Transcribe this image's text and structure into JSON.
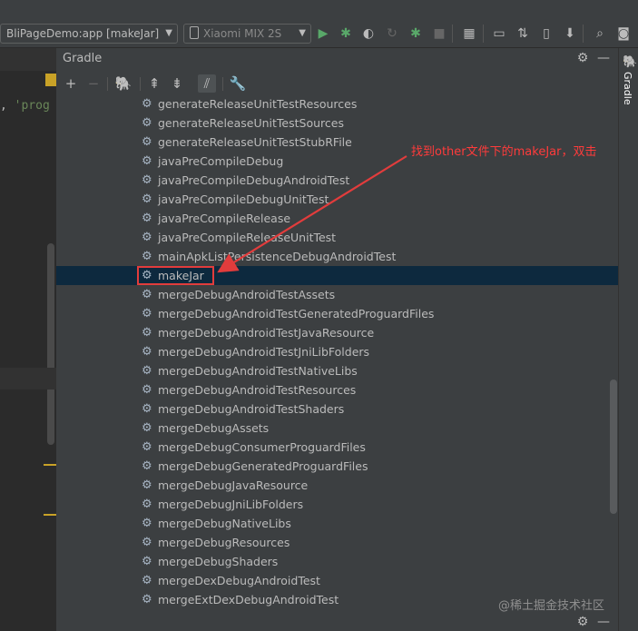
{
  "toolbar": {
    "run_config": "BliPageDemo:app [makeJar]",
    "device": "Xiaomi MIX 2S"
  },
  "editor": {
    "code_fragment_punct": ", ",
    "code_fragment_string": "'prog"
  },
  "gradle": {
    "title": "Gradle",
    "tasks": [
      "generateReleaseUnitTestResources",
      "generateReleaseUnitTestSources",
      "generateReleaseUnitTestStubRFile",
      "javaPreCompileDebug",
      "javaPreCompileDebugAndroidTest",
      "javaPreCompileDebugUnitTest",
      "javaPreCompileRelease",
      "javaPreCompileReleaseUnitTest",
      "mainApkListPersistenceDebugAndroidTest",
      "makeJar",
      "mergeDebugAndroidTestAssets",
      "mergeDebugAndroidTestGeneratedProguardFiles",
      "mergeDebugAndroidTestJavaResource",
      "mergeDebugAndroidTestJniLibFolders",
      "mergeDebugAndroidTestNativeLibs",
      "mergeDebugAndroidTestResources",
      "mergeDebugAndroidTestShaders",
      "mergeDebugAssets",
      "mergeDebugConsumerProguardFiles",
      "mergeDebugGeneratedProguardFiles",
      "mergeDebugJavaResource",
      "mergeDebugJniLibFolders",
      "mergeDebugNativeLibs",
      "mergeDebugResources",
      "mergeDebugShaders",
      "mergeDexDebugAndroidTest",
      "mergeExtDexDebugAndroidTest"
    ],
    "selected_task": "makeJar"
  },
  "right_stripe": {
    "label": "Gradle"
  },
  "annotation": {
    "text": "找到other文件下的makeJar，双击"
  },
  "watermark": "@稀土掘金技术社区",
  "colors": {
    "accent_annotation": "#e23c3c",
    "selection_bg": "#0d293e",
    "run_green": "#59a869"
  }
}
